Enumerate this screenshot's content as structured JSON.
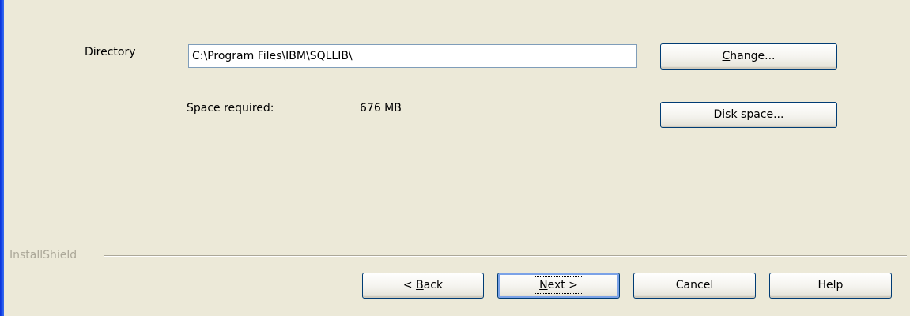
{
  "directory": {
    "label": "Directory",
    "value": "C:\\Program Files\\IBM\\SQLLIB\\"
  },
  "change_button": {
    "mnemonic": "C",
    "rest": "hange..."
  },
  "space": {
    "label": "Space required:",
    "value": "676 MB"
  },
  "disk_space_button": {
    "mnemonic": "D",
    "rest": "isk space..."
  },
  "footer": {
    "brand": "InstallShield"
  },
  "nav": {
    "back": {
      "prefix": "< ",
      "mnemonic": "B",
      "rest": "ack"
    },
    "next": {
      "mnemonic": "N",
      "rest": "ext >"
    },
    "cancel": "Cancel",
    "help": "Help"
  },
  "colors": {
    "background": "#ECE9D8",
    "frame_accent": "#0831D9",
    "button_border": "#003C74",
    "brand_text": "#ACA899"
  }
}
